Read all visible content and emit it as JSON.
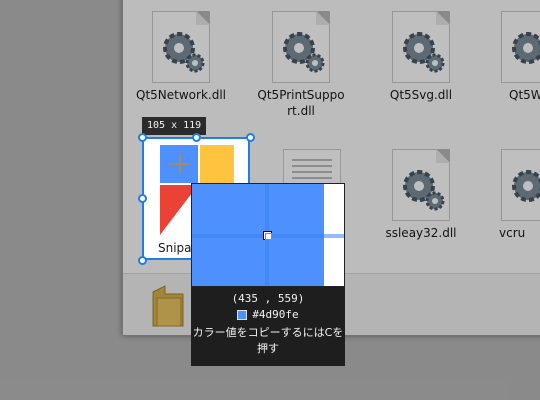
{
  "files": [
    {
      "name": "Qt5Network.dll",
      "icon": "dll-gear-icon"
    },
    {
      "name": "Qt5PrintSupport.dll",
      "icon": "dll-gear-icon"
    },
    {
      "name": "Qt5Svg.dll",
      "icon": "dll-gear-icon"
    },
    {
      "name": "Qt5W",
      "icon": "dll-gear-icon"
    },
    {
      "name": "Snipa",
      "icon": "snipaste-logo-icon"
    },
    {
      "name": "ssleay32.dll",
      "icon": "dll-gear-icon"
    },
    {
      "name": "vcru",
      "icon": "dll-gear-icon"
    }
  ],
  "selection": {
    "size_label": "105 x 119"
  },
  "magnifier": {
    "coords": "(435 , 559)",
    "hex": "#4d90fe",
    "hint": "カラー値をコピーするにはCを押す"
  },
  "colors": {
    "accent": "#1f7de6",
    "picked": "#4d90fe"
  }
}
